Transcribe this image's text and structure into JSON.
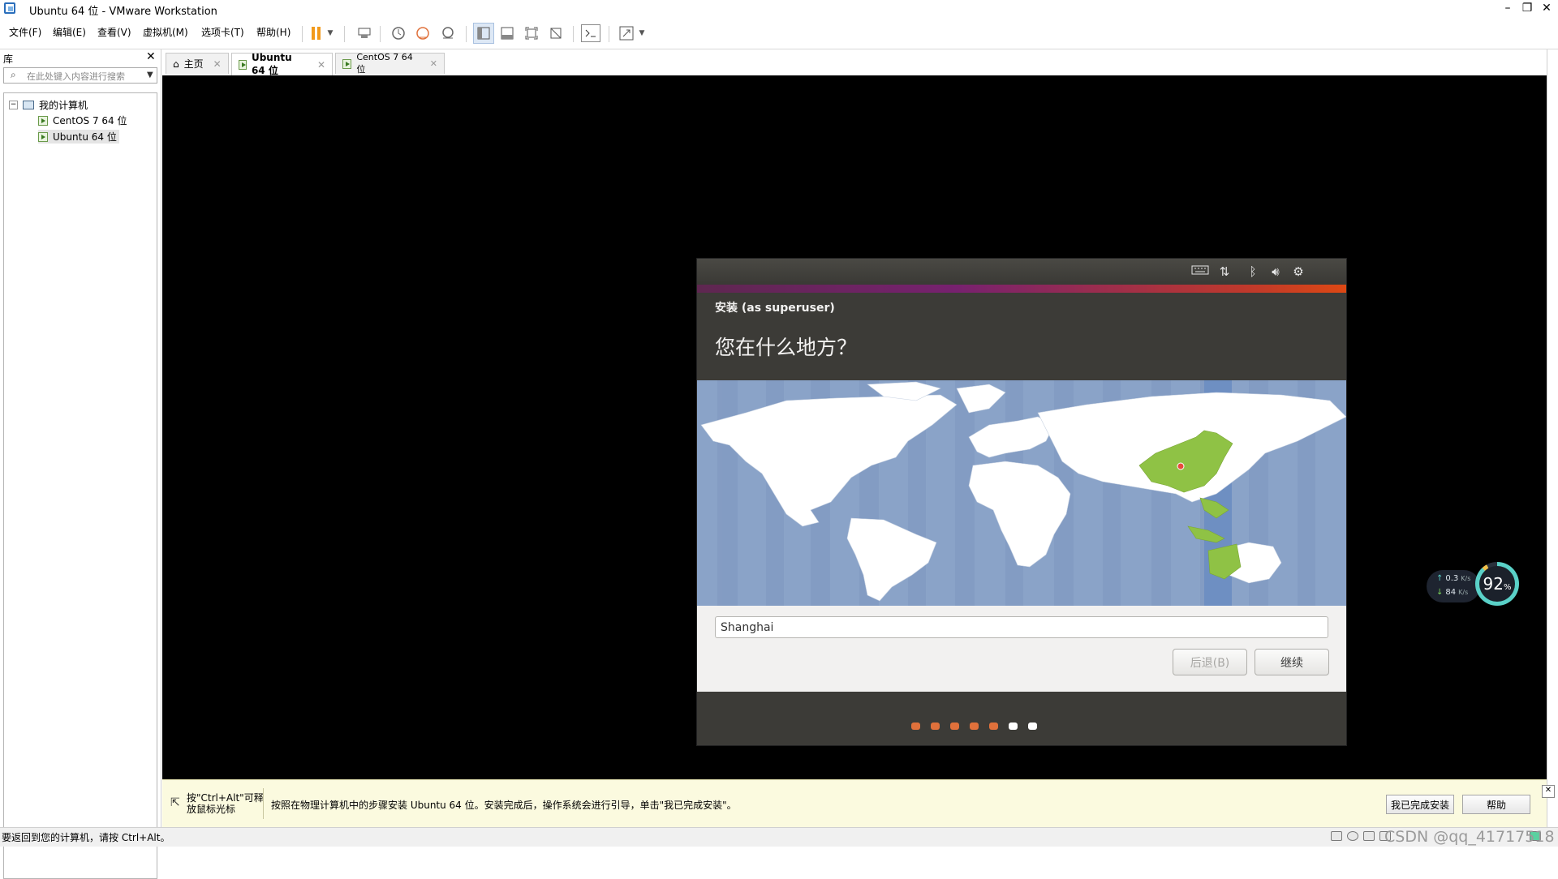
{
  "window": {
    "title": "Ubuntu 64 位 - VMware Workstation",
    "controls": {
      "minimize": "–",
      "restore": "❐",
      "close": "✕"
    }
  },
  "menubar": {
    "items": [
      "文件(F)",
      "编辑(E)",
      "查看(V)",
      "虚拟机(M)",
      "选项卡(T)",
      "帮助(H)"
    ],
    "toolbar_icons": [
      "pause-icon",
      "dropdown-icon",
      "send-ctrl-alt-del-icon",
      "snapshot-icon",
      "revert-snapshot-icon",
      "snapshot-manager-icon",
      "show-library-icon",
      "thumbnail-bar-icon",
      "full-screen-icon",
      "unity-icon",
      "console-view-icon",
      "stretch-guest-icon"
    ]
  },
  "library": {
    "title": "库",
    "close": "✕",
    "search_placeholder": "在此处键入内容进行搜索",
    "tree": {
      "root": "我的计算机",
      "children": [
        "CentOS 7 64 位",
        "Ubuntu 64 位"
      ],
      "selected": "Ubuntu 64 位"
    }
  },
  "tabs": [
    {
      "label": "主页",
      "icon": "home-icon",
      "active": false
    },
    {
      "label": "Ubuntu 64 位",
      "icon": "vm-icon",
      "active": true
    },
    {
      "label": "CentOS 7 64 位",
      "icon": "vm-icon",
      "active": false
    }
  ],
  "installer": {
    "panel_icons": [
      "keyboard-icon",
      "network-icon",
      "bluetooth-icon",
      "volume-icon",
      "settings-icon"
    ],
    "subtitle": "安装 (as superuser)",
    "title": "您在什么地方？",
    "location_value": "Shanghai",
    "back_label": "后退(B)",
    "back_enabled": false,
    "next_label": "继续",
    "progress": {
      "total": 7,
      "completed": 5,
      "active_color": "#e0713b",
      "inactive_color": "#ffffff"
    },
    "map": {
      "ocean_color": "#8aa3c8",
      "land_color": "#ffffff",
      "highlight_color": "#8fc245",
      "selected_city": "Shanghai"
    }
  },
  "net_widget": {
    "upload": "0.3",
    "upload_unit": "K/s",
    "download": "84",
    "download_unit": "K/s",
    "percent": "92",
    "percent_unit": "%"
  },
  "hint_bar": {
    "release_hint": "按\"Ctrl+Alt\"可释放鼠标光标",
    "message": "按照在物理计算机中的步骤安装 Ubuntu 64 位。安装完成后，操作系统会进行引导，单击\"我已完成安装\"。",
    "done_button": "我已完成安装",
    "help_button": "帮助"
  },
  "statusbar": {
    "text": "要返回到您的计算机，请按 Ctrl+Alt。",
    "watermark": "CSDN @qq_41717518"
  }
}
